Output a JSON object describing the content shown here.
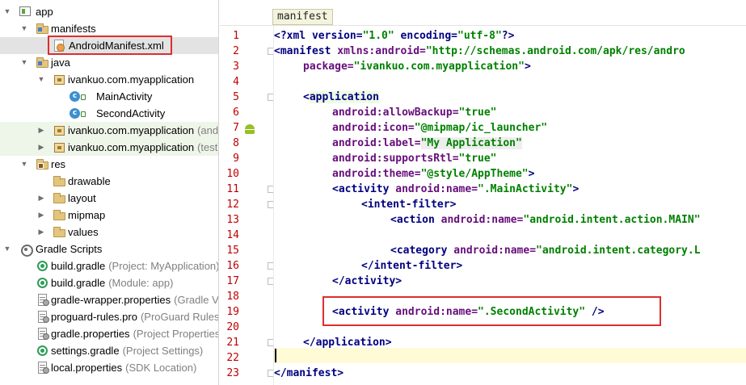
{
  "tree": {
    "app": "app",
    "manifests": "manifests",
    "manifest_file": "AndroidManifest.xml",
    "java": "java",
    "pkg_main": "ivankuo.com.myapplication",
    "main_activity": "MainActivity",
    "second_activity": "SecondActivity",
    "pkg_android_test": "ivankuo.com.myapplication",
    "pkg_android_test_sub": "(andr",
    "pkg_test": "ivankuo.com.myapplication",
    "pkg_test_sub": "(test)",
    "res": "res",
    "drawable": "drawable",
    "layout": "layout",
    "mipmap": "mipmap",
    "values": "values",
    "gradle_scripts": "Gradle Scripts",
    "build_project": "build.gradle",
    "build_project_sub": "(Project: MyApplication)",
    "build_module": "build.gradle",
    "build_module_sub": "(Module: app)",
    "gradle_wrapper": "gradle-wrapper.properties",
    "gradle_wrapper_sub": "(Gradle V",
    "proguard": "proguard-rules.pro",
    "proguard_sub": "(ProGuard Rules",
    "gradle_props": "gradle.properties",
    "gradle_props_sub": "(Project Properties)",
    "settings": "settings.gradle",
    "settings_sub": "(Project Settings)",
    "local": "local.properties",
    "local_sub": "(SDK Location)"
  },
  "editor": {
    "tab": "manifest",
    "line_numbers": [
      "1",
      "2",
      "3",
      "4",
      "5",
      "6",
      "7",
      "8",
      "9",
      "10",
      "11",
      "12",
      "13",
      "14",
      "15",
      "16",
      "17",
      "18",
      "19",
      "20",
      "21",
      "22",
      "23"
    ],
    "code": {
      "l1": {
        "a": "<?xml version=",
        "b": "\"1.0\"",
        "c": " encoding=",
        "d": "\"utf-8\"",
        "e": "?>"
      },
      "l2": {
        "a": "<manifest ",
        "b": "xmlns:android=",
        "c": "\"http://schemas.android.com/apk/res/andro"
      },
      "l3": {
        "a": "package=",
        "b": "\"ivankuo.com.myapplication\"",
        "c": ">"
      },
      "l5": {
        "a": "<",
        "b": "application"
      },
      "l6": {
        "a": "android:allowBackup=",
        "b": "\"true\""
      },
      "l7": {
        "a": "android:icon=",
        "b": "\"@mipmap/ic_launcher\""
      },
      "l8": {
        "a": "android:label=",
        "b": "\"My Application\""
      },
      "l9": {
        "a": "android:supportsRtl=",
        "b": "\"true\""
      },
      "l10": {
        "a": "android:theme=",
        "b": "\"@style/AppTheme\"",
        "c": ">"
      },
      "l11": {
        "a": "<activity ",
        "b": "android:name=",
        "c": "\".MainActivity\"",
        "d": ">"
      },
      "l12": {
        "a": "<intent-filter>"
      },
      "l13": {
        "a": "<action ",
        "b": "android:name=",
        "c": "\"android.intent.action.MAIN\""
      },
      "l15": {
        "a": "<category ",
        "b": "android:name=",
        "c": "\"android.intent.category.L"
      },
      "l16": {
        "a": "</intent-filter>"
      },
      "l17": {
        "a": "</activity>"
      },
      "l19": {
        "a": "<activity ",
        "b": "android:name=",
        "c": "\".SecondActivity\"",
        "d": " />"
      },
      "l21": {
        "a": "</application>"
      },
      "l23": {
        "a": "</manifest>"
      }
    }
  },
  "colors": {
    "line_number": "#c00000",
    "tag": "#000080",
    "attr_name": "#660e7a",
    "attr_value": "#008000",
    "highlight_box": "#dd2e2e"
  }
}
